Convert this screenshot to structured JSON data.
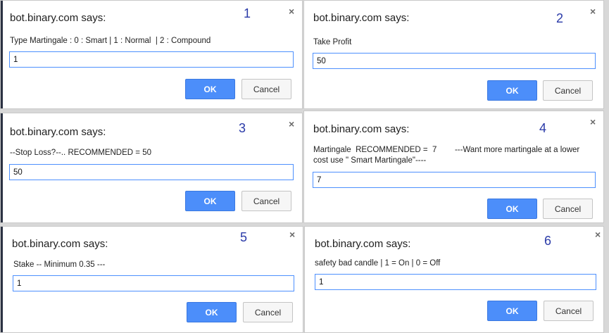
{
  "dialogs": [
    {
      "title": "bot.binary.com says:",
      "number": "1",
      "message": "Type Martingale : 0 : Smart | 1 : Normal  | 2 : Compound",
      "value": "1",
      "ok_label": "OK",
      "cancel_label": "Cancel",
      "close_icon": "×"
    },
    {
      "title": "bot.binary.com says:",
      "number": "2",
      "message": "Take Profit",
      "value": "50",
      "ok_label": "OK",
      "cancel_label": "Cancel",
      "close_icon": "×"
    },
    {
      "title": "bot.binary.com says:",
      "number": "3",
      "message": "--Stop Loss?--.. RECOMMENDED = 50",
      "value": "50",
      "ok_label": "OK",
      "cancel_label": "Cancel",
      "close_icon": "×"
    },
    {
      "title": "bot.binary.com says:",
      "number": "4",
      "message": "Martingale  RECOMMENDED =  7        ---Want more martingale at a lower\ncost use \" Smart Martingale\"----",
      "value": "7",
      "ok_label": "OK",
      "cancel_label": "Cancel",
      "close_icon": "×"
    },
    {
      "title": "bot.binary.com says:",
      "number": "5",
      "message": "Stake -- Minimum 0.35 ---",
      "value": "1",
      "ok_label": "OK",
      "cancel_label": "Cancel",
      "close_icon": "×"
    },
    {
      "title": "bot.binary.com says:",
      "number": "6",
      "message": "safety bad candle | 1 = On | 0 = Off",
      "value": "1",
      "ok_label": "OK",
      "cancel_label": "Cancel",
      "close_icon": "×"
    }
  ],
  "colors": {
    "ok_button": "#4c8efa",
    "number_label": "#2a3aa8",
    "input_border": "#4d90fe"
  }
}
